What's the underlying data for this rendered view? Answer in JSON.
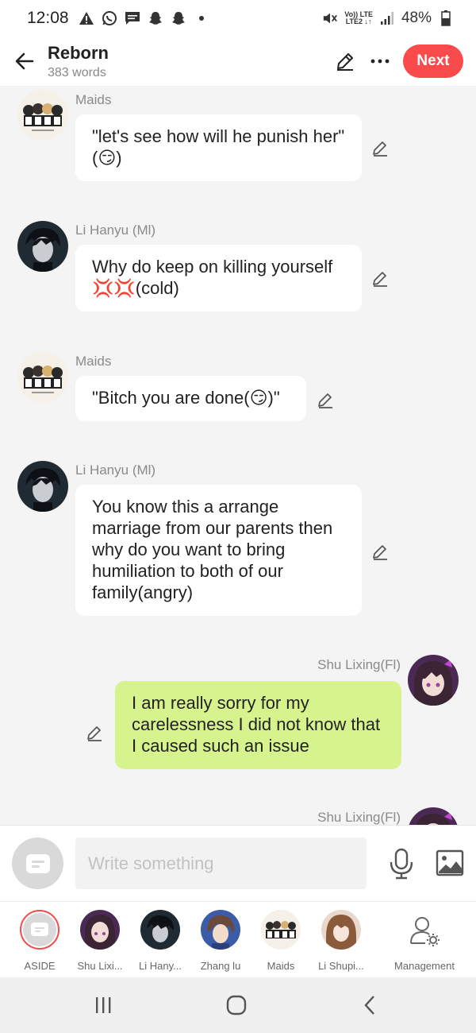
{
  "status_bar": {
    "time": "12:08",
    "lte_top": "Vo)) LTE",
    "lte_bottom": "LTE2 ↓↑",
    "battery": "48%",
    "icons": [
      "warning-icon",
      "whatsapp-icon",
      "message-icon",
      "snapchat-icon",
      "snapchat-icon",
      "dot-icon",
      "mute-icon",
      "signal-icon",
      "battery-icon"
    ]
  },
  "header": {
    "title": "Reborn",
    "word_count": "383 words",
    "next_label": "Next"
  },
  "messages": [
    {
      "name": "Maids",
      "text": "\"let's see how will he punish her\"(😏)",
      "side": "left"
    },
    {
      "name": "Li Hanyu (Ml)",
      "text": "Why do keep on killing yourself 💢💢(cold)",
      "side": "left"
    },
    {
      "name": "Maids",
      "text": "\"Bitch you are done(😏)\"",
      "side": "left"
    },
    {
      "name": "Li Hanyu (Ml)",
      "text": "You know this a arrange marriage from our parents then why do you want to bring humiliation to both of our family(angry)",
      "side": "left"
    },
    {
      "name": "Shu Lixing(Fl)",
      "text": "I am really sorry for my carelessness I did not know that I caused such an issue",
      "side": "right"
    },
    {
      "name": "Shu Lixing(Fl)",
      "text": "",
      "side": "right"
    }
  ],
  "input": {
    "placeholder": "Write something"
  },
  "characters": [
    {
      "label": "ASIDE"
    },
    {
      "label": "Shu Lixi..."
    },
    {
      "label": "Li Hany..."
    },
    {
      "label": "Zhang lu"
    },
    {
      "label": "Maids"
    },
    {
      "label": "Li Shupi..."
    },
    {
      "label": "Management"
    }
  ],
  "colors": {
    "accent": "#f94a4c",
    "my_bubble": "#d7f38e",
    "background": "#f4f4f4"
  }
}
